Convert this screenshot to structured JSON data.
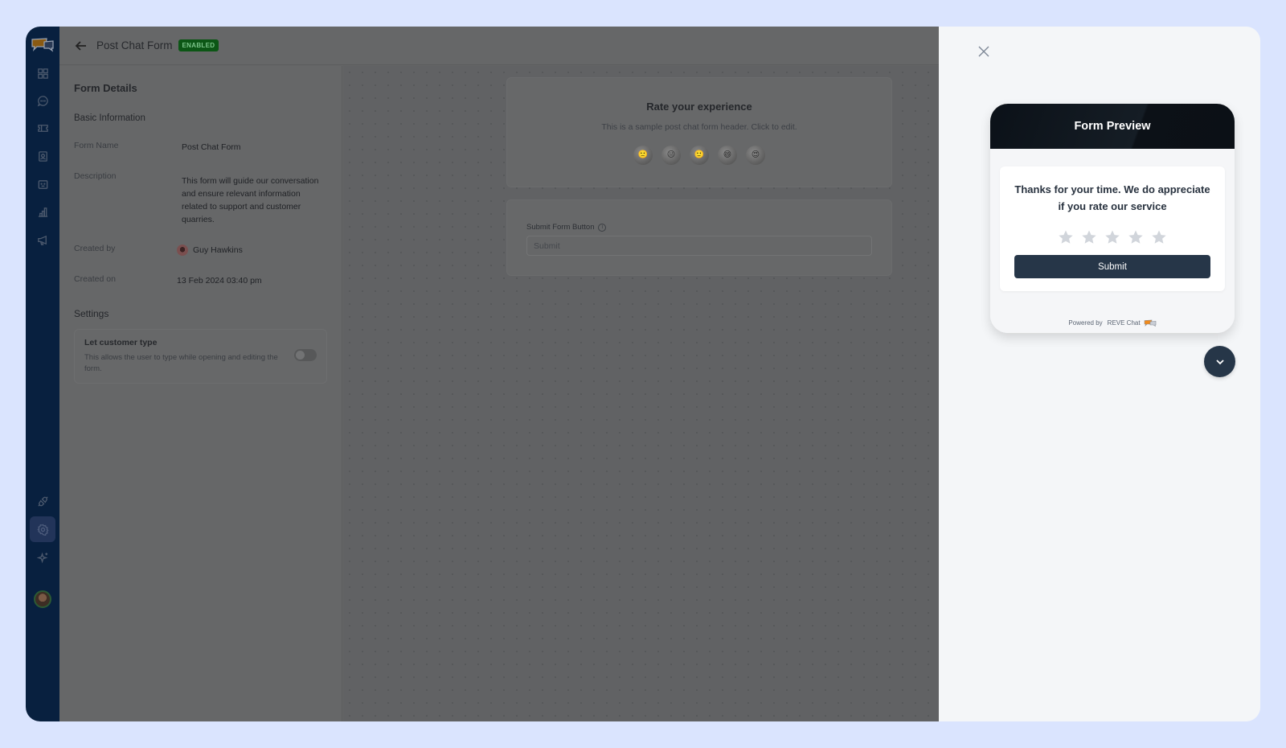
{
  "header": {
    "title": "Post Chat Form",
    "status_badge": "ENABLED"
  },
  "sidebar": {
    "items": [
      {
        "icon": "dashboard-icon"
      },
      {
        "icon": "chat-icon"
      },
      {
        "icon": "ticket-icon"
      },
      {
        "icon": "contacts-icon"
      },
      {
        "icon": "bot-icon"
      },
      {
        "icon": "reports-icon"
      },
      {
        "icon": "campaign-icon"
      }
    ],
    "bottom_items": [
      {
        "icon": "integrations-icon"
      },
      {
        "icon": "settings-icon",
        "active": true
      },
      {
        "icon": "ai-sparkle-icon"
      }
    ]
  },
  "details": {
    "heading": "Form Details",
    "section_basic": "Basic Information",
    "form_name_label": "Form Name",
    "form_name_value": "Post Chat Form",
    "description_label": "Description",
    "description_value": "This form will guide our conversation and ensure relevant information related to support and customer quarries.",
    "created_by_label": "Created by",
    "created_by_value": "Guy Hawkins",
    "created_on_label": "Created on",
    "created_on_value": "13 Feb 2024 03:40 pm",
    "section_settings": "Settings",
    "setting_title": "Let customer type",
    "setting_desc": "This allows the user to type while opening and editing the form.",
    "setting_enabled": false
  },
  "editor": {
    "card_title": "Rate your experience",
    "card_subtitle": "This is a sample post chat form header. Click to edit.",
    "emojis": [
      "🙁",
      "😐",
      "🙂",
      "😄",
      "😍"
    ],
    "submit_label": "Submit Form Button",
    "submit_value": "Submit"
  },
  "preview": {
    "header": "Form Preview",
    "message": "Thanks for your time. We do appreciate if you rate our service",
    "rating_max": 5,
    "rating_value": 0,
    "submit_button": "Submit",
    "powered_by": "Powered by",
    "brand": "REVE Chat"
  }
}
